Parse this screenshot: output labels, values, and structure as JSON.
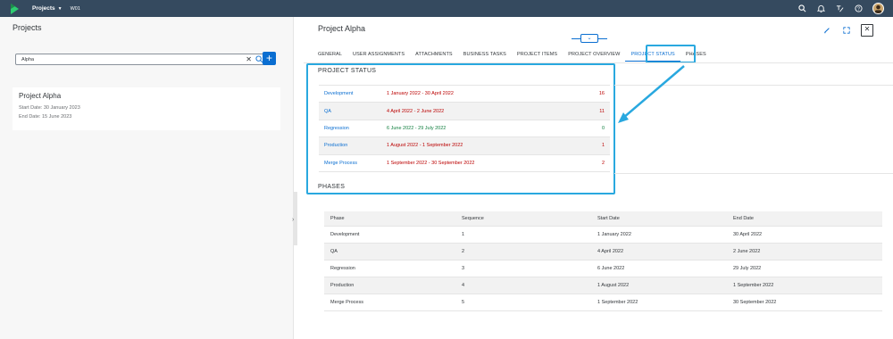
{
  "shell": {
    "app_title": "Projects",
    "system": "W01"
  },
  "left": {
    "title": "Projects",
    "search_value": "Alpha",
    "add_label": "+",
    "item": {
      "name": "Project Alpha",
      "start": "Start Date: 30 January 2023",
      "end": "End Date: 15 June 2023"
    }
  },
  "right": {
    "title": "Project Alpha",
    "tabs": [
      "GENERAL",
      "USER ASSIGNMENTS",
      "ATTACHMENTS",
      "BUSINESS TASKS",
      "PROJECT ITEMS",
      "PROJECT OVERVIEW",
      "PROJECT STATUS",
      "PHASES"
    ],
    "active_tab": "PROJECT STATUS",
    "status": {
      "title": "PROJECT STATUS",
      "rows": [
        {
          "phase": "Development",
          "range": "1 January 2022 - 30 April 2022",
          "count": "16",
          "status_color": "#bb0000"
        },
        {
          "phase": "QA",
          "range": "4 April 2022 - 2 June 2022",
          "count": "11",
          "status_color": "#bb0000"
        },
        {
          "phase": "Regression",
          "range": "6 June 2022 - 29 July 2022",
          "count": "0",
          "status_color": "#107e3e"
        },
        {
          "phase": "Production",
          "range": "1 August 2022 - 1 September 2022",
          "count": "1",
          "status_color": "#bb0000"
        },
        {
          "phase": "Merge Process",
          "range": "1 September 2022 - 30 September 2022",
          "count": "2",
          "status_color": "#bb0000"
        }
      ]
    },
    "phases": {
      "title": "PHASES",
      "headers": [
        "Phase",
        "Sequence",
        "Start Date",
        "End Date"
      ],
      "rows": [
        [
          "Development",
          "1",
          "1 January 2022",
          "30 April 2022"
        ],
        [
          "QA",
          "2",
          "4 April 2022",
          "2 June 2022"
        ],
        [
          "Regression",
          "3",
          "6 June 2022",
          "29 July 2022"
        ],
        [
          "Production",
          "4",
          "1 August 2022",
          "1 September 2022"
        ],
        [
          "Merge Process",
          "5",
          "1 September 2022",
          "30 September 2022"
        ]
      ]
    }
  },
  "colors": {
    "shell": "#354a5f",
    "accent": "#0a6ed1",
    "highlight": "#29a8df",
    "negative": "#bb0000",
    "positive": "#107e3e"
  },
  "icons": [
    "search-icon",
    "notifications-icon",
    "user-switch-icon",
    "help-icon",
    "edit-icon",
    "fullscreen-icon",
    "close-icon",
    "collapse-header-icon"
  ]
}
